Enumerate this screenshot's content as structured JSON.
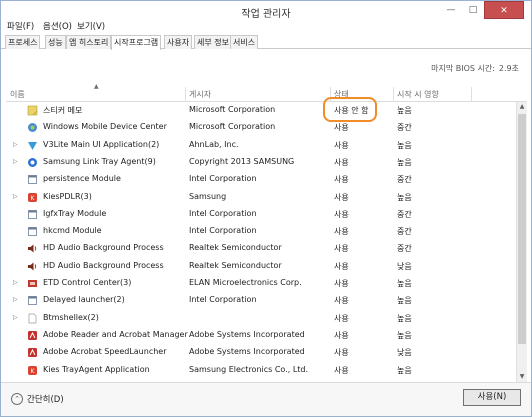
{
  "window": {
    "title": "작업 관리자",
    "minimize_glyph": "—",
    "maximize_glyph": "□",
    "close_glyph": "✕"
  },
  "menu": [
    "파일(F)",
    "옵션(O)",
    "보기(V)"
  ],
  "tabs": [
    "프로세스",
    "성능",
    "앱 히스토리",
    "시작프로그램",
    "사용자",
    "세부 정보",
    "서비스"
  ],
  "active_tab": "시작프로그램",
  "bios": {
    "label": "마지막 BIOS 시간:",
    "value": "2.9초"
  },
  "columns": {
    "name": "이름",
    "publisher": "게시자",
    "status": "상태",
    "impact": "시작 시 영향"
  },
  "rows": [
    {
      "name": "스티커 메모",
      "publisher": "Microsoft Corporation",
      "status": "사용 안 함",
      "impact": "높음",
      "icon": "sticky-notes-icon",
      "expandable": false
    },
    {
      "name": "Windows Mobile Device Center",
      "publisher": "Microsoft Corporation",
      "status": "사용",
      "impact": "중간",
      "icon": "mobile-device-icon",
      "expandable": false
    },
    {
      "name": "V3Lite Main UI Application(2)",
      "publisher": "AhnLab, Inc.",
      "status": "사용",
      "impact": "높음",
      "icon": "v3lite-icon",
      "expandable": true
    },
    {
      "name": "Samsung Link Tray Agent(9)",
      "publisher": "Copyright 2013 SAMSUNG",
      "status": "사용",
      "impact": "높음",
      "icon": "samsung-link-icon",
      "expandable": true
    },
    {
      "name": "persistence Module",
      "publisher": "Intel Corporation",
      "status": "사용",
      "impact": "중간",
      "icon": "app-icon",
      "expandable": false
    },
    {
      "name": "KiesPDLR(3)",
      "publisher": "Samsung",
      "status": "사용",
      "impact": "높음",
      "icon": "kies-icon",
      "expandable": true
    },
    {
      "name": "IgfxTray Module",
      "publisher": "Intel Corporation",
      "status": "사용",
      "impact": "중간",
      "icon": "app-icon",
      "expandable": false
    },
    {
      "name": "hkcmd Module",
      "publisher": "Intel Corporation",
      "status": "사용",
      "impact": "중간",
      "icon": "app-icon",
      "expandable": false
    },
    {
      "name": "HD Audio Background Process",
      "publisher": "Realtek Semiconductor",
      "status": "사용",
      "impact": "중간",
      "icon": "speaker-icon",
      "expandable": false
    },
    {
      "name": "HD Audio Background Process",
      "publisher": "Realtek Semiconductor",
      "status": "사용",
      "impact": "낮음",
      "icon": "speaker-icon",
      "expandable": false
    },
    {
      "name": "ETD Control Center(3)",
      "publisher": "ELAN Microelectronics Corp.",
      "status": "사용",
      "impact": "높음",
      "icon": "etd-icon",
      "expandable": true
    },
    {
      "name": "Delayed launcher(2)",
      "publisher": "Intel Corporation",
      "status": "사용",
      "impact": "높음",
      "icon": "app-icon",
      "expandable": true
    },
    {
      "name": "Btmshellex(2)",
      "publisher": "",
      "status": "사용",
      "impact": "높음",
      "icon": "file-icon",
      "expandable": true
    },
    {
      "name": "Adobe Reader and Acrobat Manager",
      "publisher": "Adobe Systems Incorporated",
      "status": "사용",
      "impact": "높음",
      "icon": "adobe-icon",
      "expandable": false
    },
    {
      "name": "Adobe Acrobat SpeedLauncher",
      "publisher": "Adobe Systems Incorporated",
      "status": "사용",
      "impact": "낮음",
      "icon": "adobe-icon",
      "expandable": false
    },
    {
      "name": "Kies TrayAgent Application",
      "publisher": "Samsung Electronics Co., Ltd.",
      "status": "사용",
      "impact": "높음",
      "icon": "kies-icon",
      "expandable": false
    }
  ],
  "footer": {
    "fewer_details": "간단히(D)",
    "fewer_glyph": "⌃",
    "enable_button": "사용(N)"
  },
  "colors": {
    "highlight": "#f08c2a",
    "sticky": "#e9d36a",
    "mobile": "#4a8bd4",
    "v3lite": "#3a9ad9",
    "samsung": "#2b6fd1",
    "kies": "#d9432f",
    "speaker": "#7a2c1a",
    "etd": "#c23a2b",
    "adobe": "#c4302b"
  }
}
